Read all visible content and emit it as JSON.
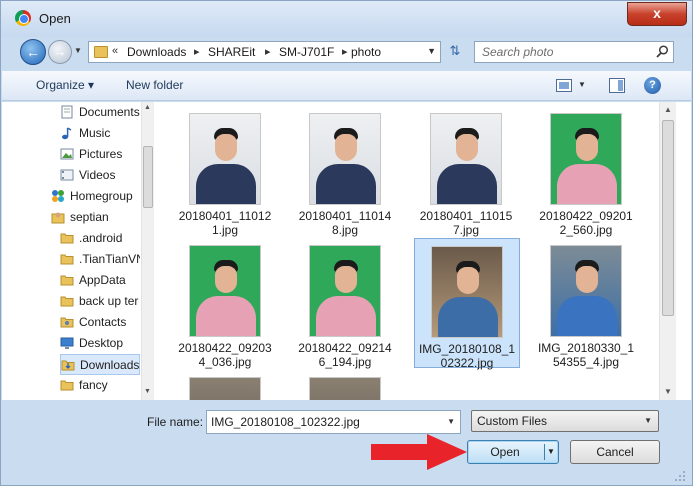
{
  "window": {
    "title": "Open",
    "close_label": "x"
  },
  "navigation": {
    "back_icon": "arrow-left-icon",
    "forward_icon": "arrow-right-icon",
    "breadcrumb_prefix": "«",
    "breadcrumbs": [
      "Downloads",
      "SHAREit",
      "SM-J701F",
      "photo"
    ],
    "search_placeholder": "Search photo"
  },
  "toolbar": {
    "organize_label": "Organize ▾",
    "new_folder_label": "New folder",
    "help_label": "?"
  },
  "sidebar": {
    "items": [
      {
        "label": "Documents",
        "icon": "documents-icon"
      },
      {
        "label": "Music",
        "icon": "music-icon"
      },
      {
        "label": "Pictures",
        "icon": "pictures-icon"
      },
      {
        "label": "Videos",
        "icon": "videos-icon"
      },
      {
        "label": "Homegroup",
        "icon": "homegroup-icon"
      },
      {
        "label": "septian",
        "icon": "user-folder-icon"
      },
      {
        "label": ".android",
        "icon": "folder-icon"
      },
      {
        "label": ".TianTianVN",
        "icon": "folder-icon"
      },
      {
        "label": "AppData",
        "icon": "folder-icon"
      },
      {
        "label": "back up ter",
        "icon": "folder-icon"
      },
      {
        "label": "Contacts",
        "icon": "contacts-icon"
      },
      {
        "label": "Desktop",
        "icon": "desktop-icon"
      },
      {
        "label": "Downloads",
        "icon": "downloads-icon"
      },
      {
        "label": "fancy",
        "icon": "folder-icon"
      }
    ]
  },
  "files": [
    {
      "label": "20180401_110121.jpg"
    },
    {
      "label": "20180401_110148.jpg"
    },
    {
      "label": "20180401_110157.jpg"
    },
    {
      "label": "20180422_092012_560.jpg"
    },
    {
      "label": "20180422_092034_036.jpg"
    },
    {
      "label": "20180422_092146_194.jpg"
    },
    {
      "label": "IMG_20180108_102322.jpg"
    },
    {
      "label": "IMG_20180330_154355_4.jpg"
    }
  ],
  "bottom": {
    "file_name_label": "File name:",
    "file_name_value": "IMG_20180108_102322.jpg",
    "filter_value": "Custom Files",
    "open_label": "Open",
    "cancel_label": "Cancel"
  },
  "colors": {
    "accent_arrow": "#e8232a",
    "selection": "#cce4fb"
  }
}
